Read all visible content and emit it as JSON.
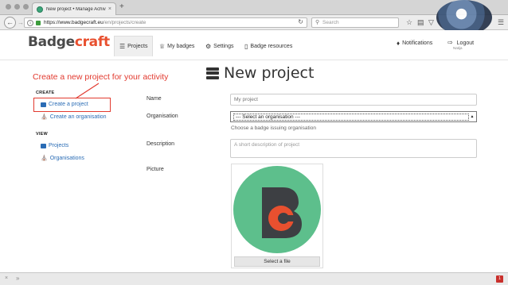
{
  "browser": {
    "tab_title": "New project • Manage Achiv...",
    "tab_close": "×",
    "new_tab": "+",
    "url_host": "https://www.badgecraft.eu",
    "url_path": "/en/projects/create",
    "search_placeholder": "Search",
    "bottom_badge": "1"
  },
  "header": {
    "logo_part1": "Badge",
    "logo_part2": "craft",
    "nav": [
      {
        "label": "Projects",
        "icon": "list-icon",
        "active": true
      },
      {
        "label": "My badges",
        "icon": "trophy-icon",
        "active": false
      },
      {
        "label": "Settings",
        "icon": "gears-icon",
        "active": false
      },
      {
        "label": "Badge resources",
        "icon": "book-icon",
        "active": false
      }
    ],
    "notifications": "Notifications",
    "logout": "Logout",
    "logout_user": "Natija"
  },
  "annotation": {
    "text": "Create a new project for your activity",
    "color": "#e23a2f"
  },
  "sidebar": {
    "create_heading": "CREATE",
    "create_items": [
      "Create a project",
      "Create an organisation"
    ],
    "view_heading": "VIEW",
    "view_items": [
      "Projects",
      "Organisations"
    ]
  },
  "main": {
    "title": "New project",
    "name_label": "Name",
    "name_placeholder": "My project",
    "org_label": "Organisation",
    "org_selected": "--- Select an organisation ---",
    "org_help": "Choose a badge issuing organisation",
    "desc_label": "Description",
    "desc_placeholder": "A short description of project",
    "picture_label": "Picture",
    "select_file": "Select a file"
  },
  "colors": {
    "brand_orange": "#e8502f",
    "brand_dark": "#4a4a4a",
    "link_blue": "#2a6cb5",
    "badge_green": "#5dbf8c"
  }
}
